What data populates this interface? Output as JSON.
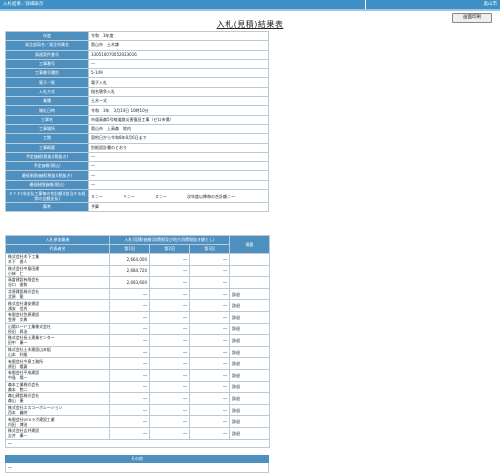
{
  "topbar": {
    "left": "入札結果／詳細表示",
    "right": "奥山市"
  },
  "print_button": "画面印刷",
  "title": "入札(見積)結果表",
  "info_rows": [
    {
      "label": "年度",
      "value": "令和　3年度"
    },
    {
      "label": "発注部局名／発注所属名",
      "value": "奥山市　土木課"
    },
    {
      "label": "調達案件番号",
      "value": "330510070052023016"
    },
    {
      "label": "工事番号",
      "value": "―"
    },
    {
      "label": "工事番号種別",
      "value": "5-149"
    },
    {
      "label": "電子／紙",
      "value": "電子入札"
    },
    {
      "label": "入札方式",
      "value": "指名競争入札"
    },
    {
      "label": "業種",
      "value": "土木一式"
    },
    {
      "label": "開札日時",
      "value": "令和　3年　3月14日 10時10分"
    },
    {
      "label": "工事名",
      "value": "市道高森5号線道路災害復旧工事（ゼロ市債）"
    },
    {
      "label": "工事場所",
      "value": "奥山市　上高森　地内"
    },
    {
      "label": "工期",
      "value": "契約日から令和8年8月6日まで"
    },
    {
      "label": "工事概要",
      "value": "別紙設計書のとおり"
    },
    {
      "label": "予定価格(税抜)(税抜き)",
      "value": "―"
    },
    {
      "label": "予定価格(税込)",
      "value": "―"
    },
    {
      "label": "最低制限価格(税抜)(税抜き)",
      "value": "―"
    },
    {
      "label": "最低制限価格(税込)",
      "value": "―"
    },
    {
      "label": "ＸＹＺ(市支払工事毎の合計額)(該当する経常の全額支払)",
      "value": "Ｘ＝ー　　　　　Ｙ＝ー　　　　　Ｚ＝ー　　　　　次年度以降毎の合計額＝ー",
      "tall": true
    },
    {
      "label": "備考",
      "value": "予算"
    }
  ],
  "bidders": {
    "header_company": "入札参加業者",
    "header_company_sub": "代表者名",
    "header_bids": "入札(見積)価格(消費税及び地方消費税抜き額とし)",
    "header_round1": "第1回",
    "header_round2": "第2回",
    "header_round3": "第3回",
    "header_remarks": "摘要",
    "rows": [
      {
        "name": "株式会社木下工業\n木下　俊人",
        "r1": "2,664,000",
        "r2": "―",
        "r3": "―",
        "remark": ""
      },
      {
        "name": "株式会社中島田建\n小林　仁",
        "r1": "2,684,720",
        "r2": "―",
        "r3": "―",
        "remark": ""
      },
      {
        "name": "高倉建設有限会社\n谷口　俊和",
        "r1": "2,693,600",
        "r2": "―",
        "r3": "―",
        "remark": ""
      },
      {
        "name": "北原建設株式会社\n北原　龍",
        "r1": "―",
        "r2": "―",
        "r3": "―",
        "remark": "辞退"
      },
      {
        "name": "株式会社浦安建設\n浦安　信秀",
        "r1": "―",
        "r2": "―",
        "r3": "―",
        "remark": "辞退"
      },
      {
        "name": "有限会社笠原建設\n笠原　文典",
        "r1": "―",
        "r2": "―",
        "r3": "―",
        "remark": "辞退"
      },
      {
        "name": "山陽ロード工業株式会社\n秋田　昇治",
        "r1": "―",
        "r2": "―",
        "r3": "―",
        "remark": "辞退"
      },
      {
        "name": "株式会社長土建業センター\n田中　康一",
        "r1": "―",
        "r2": "―",
        "r3": "―",
        "remark": "辞退"
      },
      {
        "name": "株式会社土木建設山本組\n山本　利雄",
        "r1": "―",
        "r2": "―",
        "r3": "―",
        "remark": "辞退"
      },
      {
        "name": "有限会社今泉工務所\n原田　隆寛",
        "r1": "―",
        "r2": "―",
        "r3": "―",
        "remark": "辞退"
      },
      {
        "name": "有限会社平成建設\n中島　陽一",
        "r1": "―",
        "r2": "―",
        "r3": "―",
        "remark": "辞退"
      },
      {
        "name": "森本工業株式会社\n森本　勲二",
        "r1": "―",
        "r2": "―",
        "r3": "―",
        "remark": "辞退"
      },
      {
        "name": "森山建設株式会社\n森山　康",
        "r1": "―",
        "r2": "―",
        "r3": "―",
        "remark": "辞退"
      },
      {
        "name": "株式会社エスコーポレーション\n西本　義明",
        "r1": "―",
        "r2": "―",
        "r3": "―",
        "remark": "辞退"
      },
      {
        "name": "有限会社UFXラボ建設工業\n内田　博治",
        "r1": "―",
        "r2": "―",
        "r3": "―",
        "remark": "辞退"
      },
      {
        "name": "株式会社吉井建設\n吉井　康一",
        "r1": "―",
        "r2": "―",
        "r3": "―",
        "remark": "辞退"
      }
    ],
    "footer": "―"
  },
  "other": {
    "header": "その他",
    "body": "―"
  }
}
